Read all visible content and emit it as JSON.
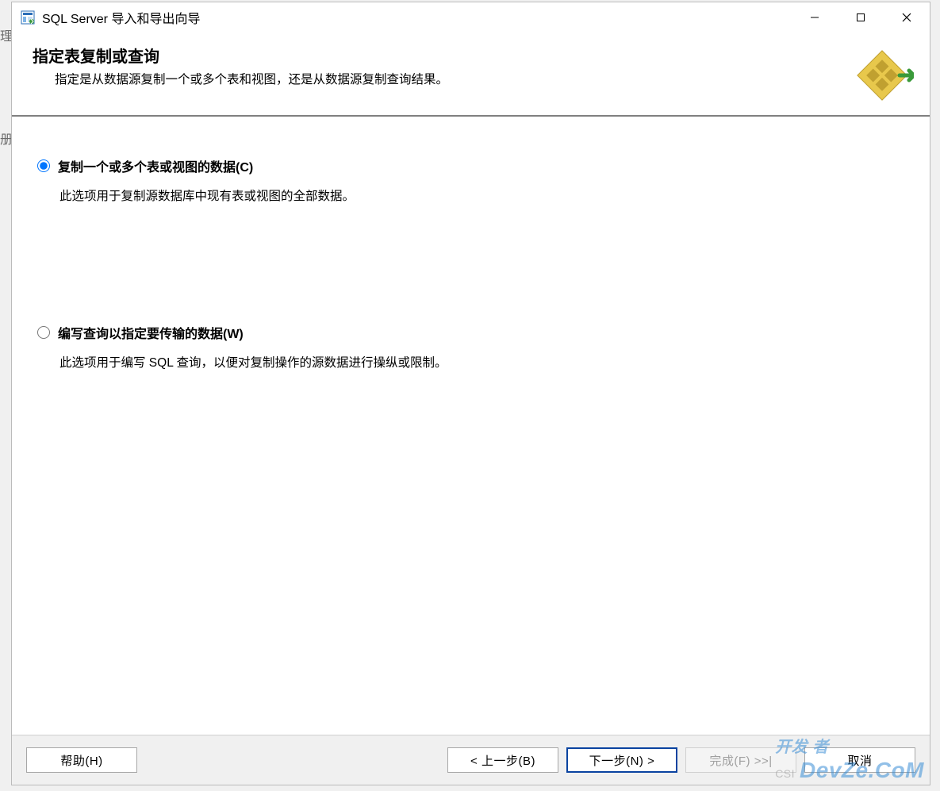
{
  "window": {
    "title": "SQL Server 导入和导出向导"
  },
  "header": {
    "title": "指定表复制或查询",
    "subtitle": "指定是从数据源复制一个或多个表和视图，还是从数据源复制查询结果。"
  },
  "options": {
    "copy": {
      "label": "复制一个或多个表或视图的数据(C)",
      "desc": "此选项用于复制源数据库中现有表或视图的全部数据。",
      "checked": true
    },
    "query": {
      "label": "编写查询以指定要传输的数据(W)",
      "desc": "此选项用于编写 SQL 查询，以便对复制操作的源数据进行操纵或限制。",
      "checked": false
    }
  },
  "buttons": {
    "help": "帮助(H)",
    "back": "< 上一步(B)",
    "next": "下一步(N) >",
    "finish": "完成(F) >>|",
    "cancel": "取消"
  },
  "watermark": {
    "line1": "开发 者",
    "line2": "DevZe.CoM",
    "csdn": "CSI"
  },
  "bg": {
    "left1": "理",
    "left2": "册"
  }
}
